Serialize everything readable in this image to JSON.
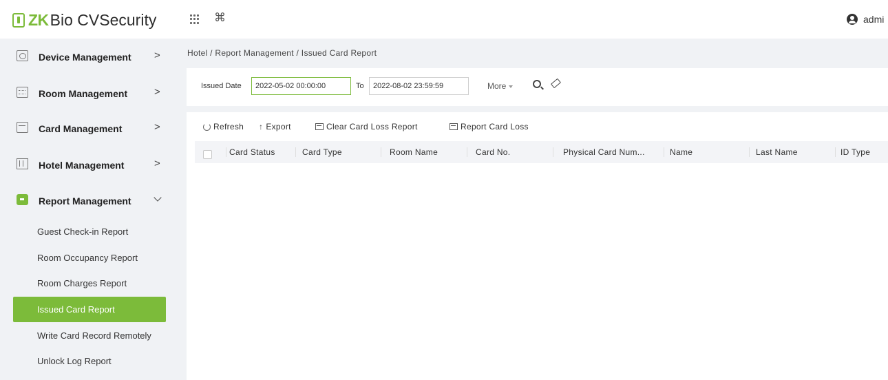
{
  "header": {
    "logo_brand": "ZK",
    "logo_rest": "Bio CVSecurity",
    "apps_icon": "grid-apps-icon",
    "shortcut_icon": "command-icon",
    "user_name": "admi"
  },
  "sidebar": {
    "menus": [
      {
        "label": "Device Management",
        "icon": "device-icon",
        "chevron": ">"
      },
      {
        "label": "Room Management",
        "icon": "room-icon",
        "chevron": ">"
      },
      {
        "label": "Card Management",
        "icon": "card-icon",
        "chevron": ">"
      },
      {
        "label": "Hotel Management",
        "icon": "hotel-icon",
        "chevron": ">"
      },
      {
        "label": "Report Management",
        "icon": "report-icon",
        "chevron": "v"
      }
    ],
    "submenu": [
      {
        "label": "Guest Check-in Report",
        "active": false
      },
      {
        "label": "Room Occupancy Report",
        "active": false
      },
      {
        "label": "Room Charges Report",
        "active": false
      },
      {
        "label": "Issued Card Report",
        "active": true
      },
      {
        "label": "Write Card Record Remotely",
        "active": false
      },
      {
        "label": "Unlock Log Report",
        "active": false
      }
    ],
    "accent_color": "#7cbb3a"
  },
  "breadcrumb": "Hotel / Report Management / Issued Card Report",
  "filter": {
    "issued_date_label": "Issued Date",
    "from_value": "2022-05-02 00:00:00",
    "to_label": "To",
    "to_value": "2022-08-02 23:59:59",
    "more_label": "More"
  },
  "toolbar": {
    "refresh": "Refresh",
    "export": "Export",
    "clear_card_loss": "Clear Card Loss Report",
    "report_card_loss": "Report Card Loss"
  },
  "table": {
    "columns": [
      "Card Status",
      "Card Type",
      "Room Name",
      "Card No.",
      "Physical Card Num...",
      "Name",
      "Last Name",
      "ID Type"
    ]
  }
}
